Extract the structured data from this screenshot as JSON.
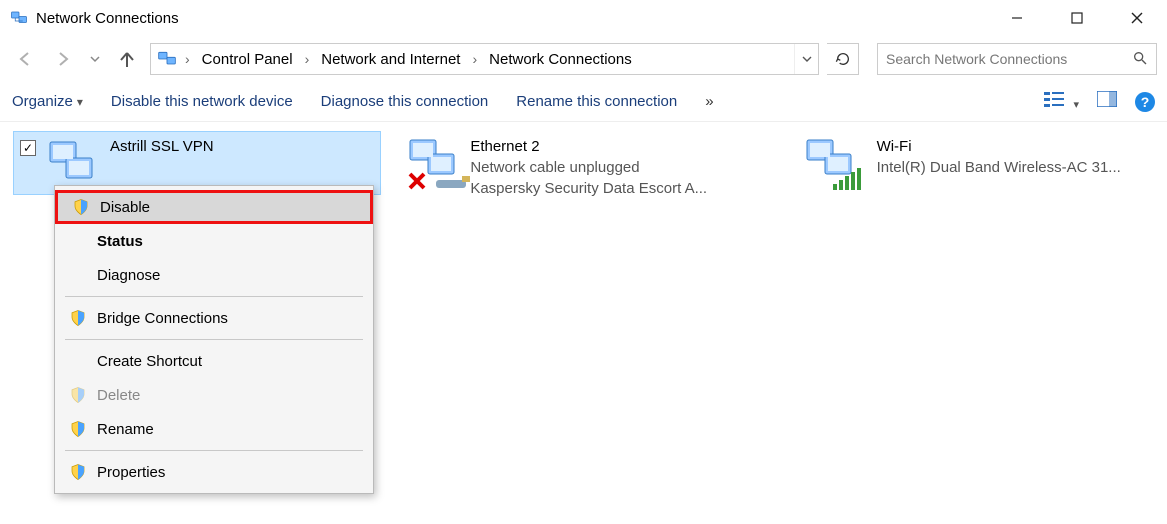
{
  "window": {
    "title": "Network Connections"
  },
  "breadcrumb": {
    "items": [
      "Control Panel",
      "Network and Internet",
      "Network Connections"
    ]
  },
  "search": {
    "placeholder": "Search Network Connections"
  },
  "toolbar": {
    "organize": "Organize",
    "disable_device": "Disable this network device",
    "diagnose": "Diagnose this connection",
    "rename": "Rename this connection",
    "overflow": "»"
  },
  "connections": [
    {
      "name": "Astrill SSL VPN",
      "status": "",
      "adapter": "",
      "selected": true,
      "checked": true
    },
    {
      "name": "Ethernet 2",
      "status": "Network cable unplugged",
      "adapter": "Kaspersky Security Data Escort A...",
      "selected": false,
      "checked": false,
      "badge": "error"
    },
    {
      "name": "Wi-Fi",
      "status": "",
      "adapter": "Intel(R) Dual Band Wireless-AC 31...",
      "selected": false,
      "checked": false,
      "badge": "signal"
    }
  ],
  "context_menu": {
    "items": [
      {
        "label": "Disable",
        "shield": true,
        "highlight": true
      },
      {
        "label": "Status",
        "bold": true
      },
      {
        "label": "Diagnose"
      },
      {
        "sep": true
      },
      {
        "label": "Bridge Connections",
        "shield": true
      },
      {
        "sep": true
      },
      {
        "label": "Create Shortcut"
      },
      {
        "label": "Delete",
        "shield": true,
        "dim": true
      },
      {
        "label": "Rename",
        "shield": true
      },
      {
        "sep": true
      },
      {
        "label": "Properties",
        "shield": true
      }
    ]
  }
}
